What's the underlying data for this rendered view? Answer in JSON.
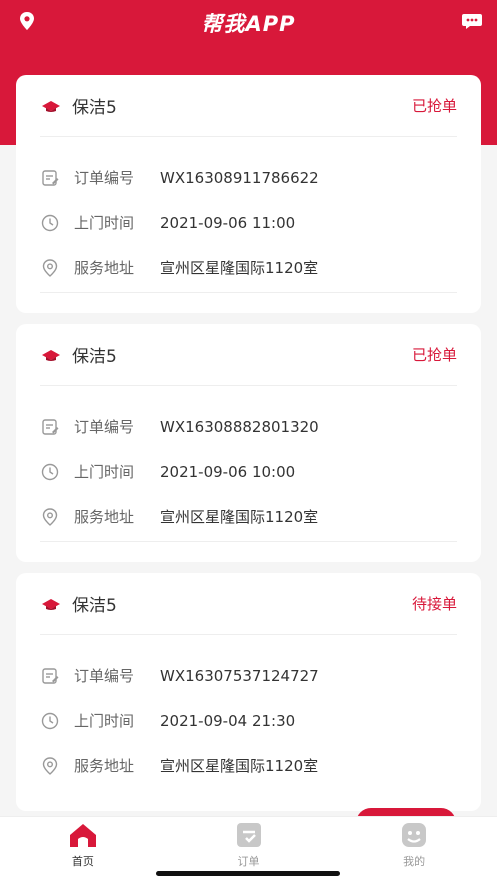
{
  "header": {
    "title": "帮我APP",
    "left_icon": "location-pin-icon",
    "right_icon": "chat-bubble-icon"
  },
  "labels": {
    "order_no": "订单编号",
    "visit_time": "上门时间",
    "address": "服务地址"
  },
  "orders": [
    {
      "service": "保洁5",
      "status": "已抢单",
      "order_no": "WX16308911786622",
      "visit_time": "2021-09-06 11:00",
      "address": "宣州区星隆国际1120室"
    },
    {
      "service": "保洁5",
      "status": "已抢单",
      "order_no": "WX16308882801320",
      "visit_time": "2021-09-06 10:00",
      "address": "宣州区星隆国际1120室"
    },
    {
      "service": "保洁5",
      "status": "待接单",
      "order_no": "WX16307537124727",
      "visit_time": "2021-09-04 21:30",
      "address": "宣州区星隆国际1120室"
    }
  ],
  "tabbar": {
    "items": [
      {
        "label": "首页",
        "icon": "home-icon",
        "active": true
      },
      {
        "label": "订单",
        "icon": "order-icon",
        "active": false
      },
      {
        "label": "我的",
        "icon": "profile-icon",
        "active": false
      }
    ]
  },
  "colors": {
    "brand": "#d8183a",
    "background": "#f5f5f5"
  }
}
